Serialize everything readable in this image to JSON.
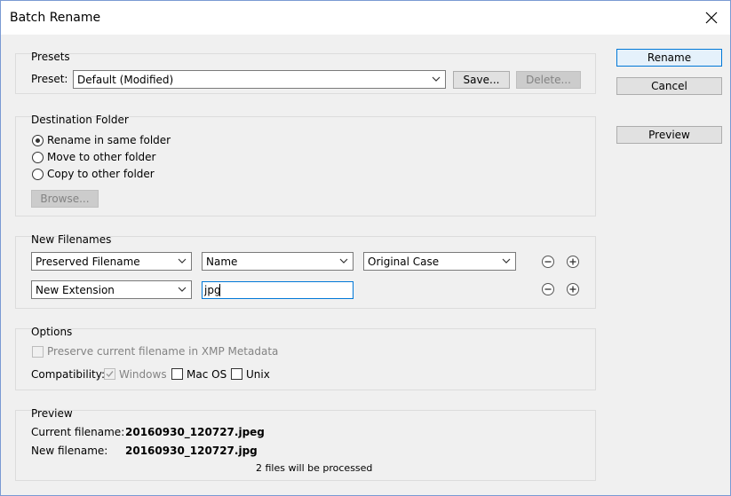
{
  "window": {
    "title": "Batch Rename"
  },
  "presets": {
    "group_label": "Presets",
    "preset_label": "Preset:",
    "preset_value": "Default (Modified)",
    "save_label": "Save...",
    "delete_label": "Delete..."
  },
  "destination": {
    "group_label": "Destination Folder",
    "options": [
      "Rename in same folder",
      "Move to other folder",
      "Copy to other folder"
    ],
    "selected": 0,
    "browse_label": "Browse..."
  },
  "new_filenames": {
    "group_label": "New Filenames",
    "row1": {
      "type": "Preserved Filename",
      "part": "Name",
      "case": "Original Case"
    },
    "row2": {
      "type": "New Extension",
      "value": "jpg"
    }
  },
  "options": {
    "group_label": "Options",
    "preserve_label": "Preserve current filename in XMP Metadata",
    "compat_label": "Compatibility:",
    "windows_label": "Windows",
    "mac_label": "Mac OS",
    "unix_label": "Unix"
  },
  "preview": {
    "group_label": "Preview",
    "current_label": "Current filename:",
    "current_value": "20160930_120727.jpeg",
    "new_label": "New filename:",
    "new_value": "20160930_120727.jpg",
    "status": "2 files will be processed"
  },
  "actions": {
    "rename_label": "Rename",
    "cancel_label": "Cancel",
    "preview_label": "Preview"
  }
}
